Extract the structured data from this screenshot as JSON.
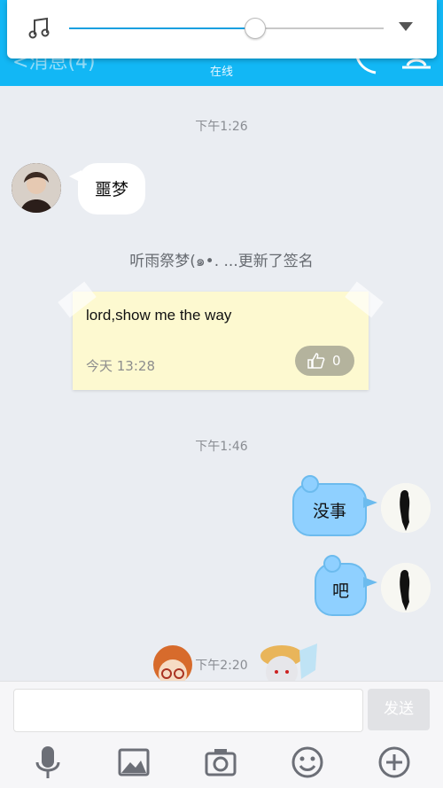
{
  "header": {
    "back_label": "消息(4)",
    "status": "在线"
  },
  "music_player": {
    "progress": 0.59
  },
  "chat": {
    "time1": "下午1:26",
    "msg1": "噩梦",
    "signature_update": "听雨祭梦(๑•. ...更新了签名",
    "signature_card": {
      "text": "lord,show me the way",
      "date": "今天 13:28",
      "likes": "0"
    },
    "time2": "下午1:46",
    "msg2": "没事",
    "msg3": "吧",
    "time3": "下午2:20"
  },
  "input": {
    "placeholder": "",
    "send_label": "发送"
  },
  "toolbar": {
    "icons": [
      "microphone-icon",
      "image-icon",
      "camera-icon",
      "emoji-icon",
      "plus-icon"
    ]
  },
  "colors": {
    "header": "#12b7f5",
    "bubble_right": "#8fd0ff",
    "note": "#fdf9d0"
  }
}
